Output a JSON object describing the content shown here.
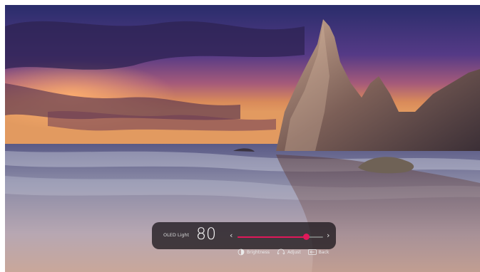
{
  "osd": {
    "label": "OLED Light",
    "value": "80",
    "level": 80,
    "max": 100,
    "left_arrow": "‹",
    "right_arrow": "›",
    "accent_color": "#e0185a"
  },
  "hints": [
    {
      "icon": "brightness-icon",
      "label": "Brightness"
    },
    {
      "icon": "adjust-icon",
      "label": "Adjust"
    },
    {
      "icon": "back-icon",
      "label": "Back"
    }
  ]
}
